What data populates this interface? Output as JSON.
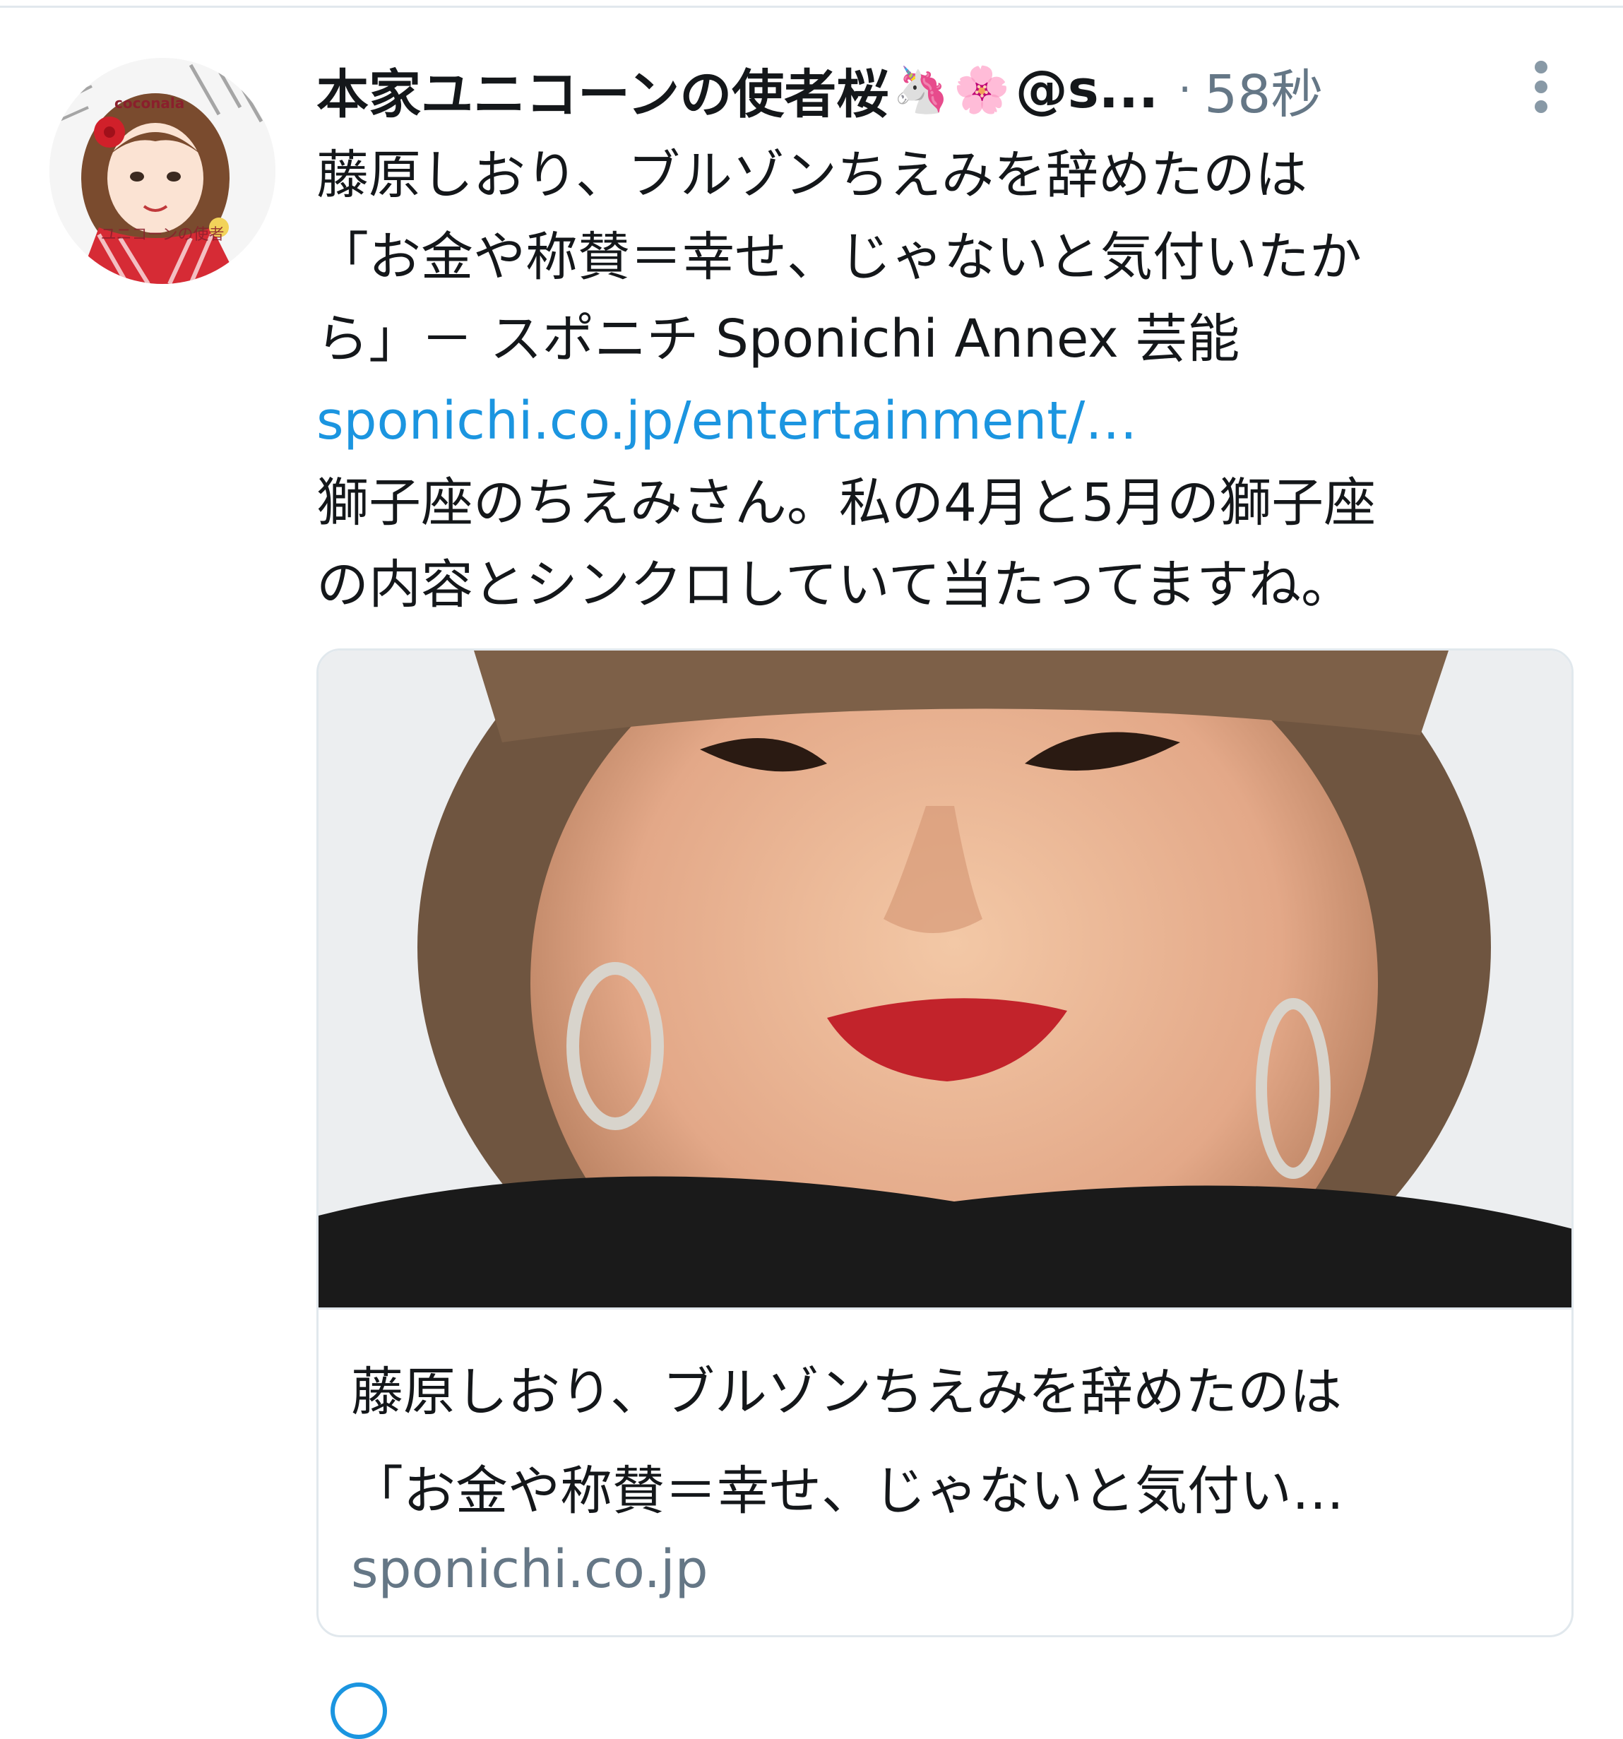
{
  "tweet": {
    "display_name": "本家ユニコーンの使者桜",
    "emoji_1": "🦄",
    "emoji_2": "🌸",
    "handle": "@s...",
    "separator": "·",
    "time": "58秒",
    "text_lines": [
      "藤原しおり、ブルゾンちえみを辞めたのは",
      "「お金や称賛＝幸せ、じゃないと気付いたか",
      "ら」－ スポニチ Sponichi Annex 芸能"
    ],
    "link": "sponichi.co.jp/entertainment/…",
    "comment_lines": [
      "獅子座のちえみさん。私の4月と5月の獅子座",
      "の内容とシンクロしていて当たってますね。"
    ]
  },
  "avatar": {
    "brand": "coconala",
    "watermark": "ユニコーンの使者"
  },
  "card": {
    "title_lines": [
      "藤原しおり、ブルゾンちえみを辞めたのは",
      "「お金や称賛＝幸せ、じゃないと気付い…"
    ],
    "domain": "sponichi.co.jp"
  },
  "icons": {
    "more": "more-vertical-icon",
    "bottom": "reply-icon"
  },
  "colors": {
    "link": "#1b95e0",
    "secondary_text": "#657786",
    "border": "#e1e8ed"
  }
}
